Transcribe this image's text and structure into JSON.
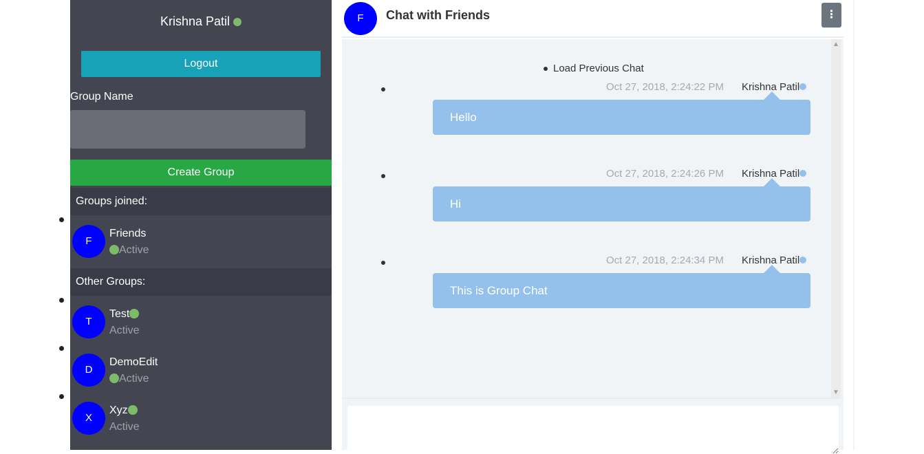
{
  "sidebar": {
    "username": "Krishna Patil",
    "logout_label": "Logout",
    "group_name_label": "Group Name",
    "group_name_value": "",
    "create_group_label": "Create Group",
    "groups_joined_label": "Groups joined:",
    "other_groups_label": "Other Groups:",
    "joined_groups": [
      {
        "initial": "F",
        "name": "Friends",
        "status": "Active"
      }
    ],
    "other_groups": [
      {
        "initial": "T",
        "name": "Test",
        "status": "Active"
      },
      {
        "initial": "D",
        "name": "DemoEdit",
        "status": "Active"
      },
      {
        "initial": "X",
        "name": "Xyz",
        "status": "Active"
      }
    ]
  },
  "chat": {
    "avatar_initial": "F",
    "title": "Chat with Friends",
    "menu_icon": "vertical-ellipsis-icon",
    "load_previous_label": "Load Previous Chat",
    "messages": [
      {
        "time": "Oct 27, 2018, 2:24:22 PM",
        "sender": "Krishna Patil",
        "text": "Hello"
      },
      {
        "time": "Oct 27, 2018, 2:24:26 PM",
        "sender": "Krishna Patil",
        "text": "Hi"
      },
      {
        "time": "Oct 27, 2018, 2:24:34 PM",
        "sender": "Krishna Patil",
        "text": "This is Group Chat"
      }
    ],
    "message_input_value": ""
  },
  "colors": {
    "sidebar_bg": "#434651",
    "section_header_bg": "#393b46",
    "logout_button": "#17a2b8",
    "create_button": "#28a745",
    "avatar": "#0000ff",
    "online_dot": "#7dbb6a",
    "bubble": "#93c1ec",
    "chat_bg": "#f1f4f7"
  }
}
